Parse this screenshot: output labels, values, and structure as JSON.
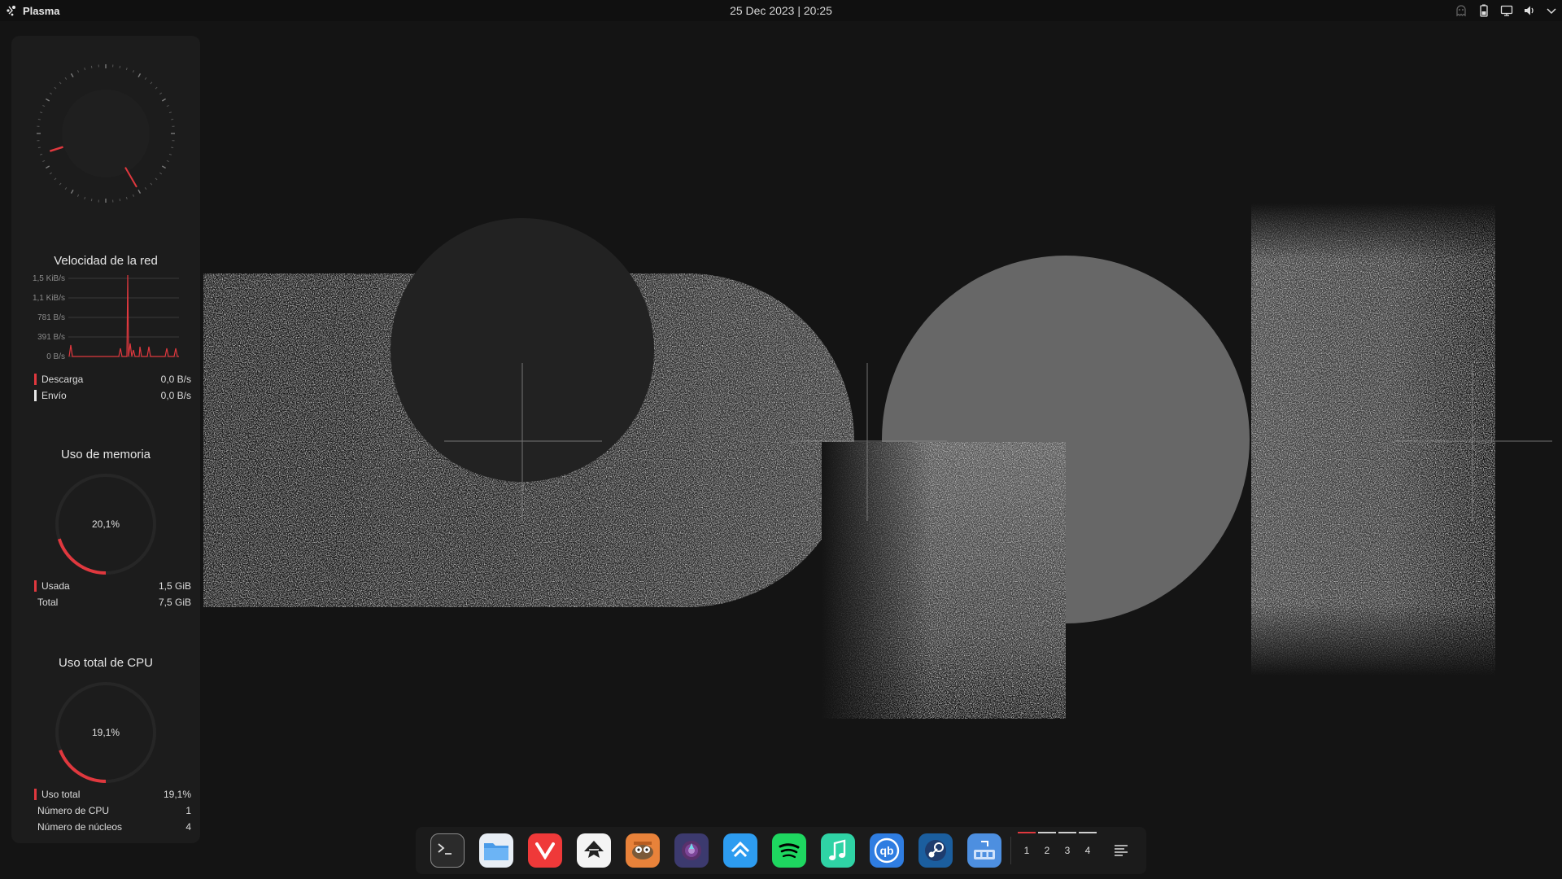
{
  "topbar": {
    "app_name": "Plasma",
    "datetime": "25 Dec 2023 | 20:25",
    "tray_icons": [
      "ghost-icon",
      "battery-icon",
      "display-icon",
      "volume-icon",
      "chevron-down-icon"
    ]
  },
  "sidebar": {
    "analog_clock": {
      "hour": 8,
      "minute": 25
    },
    "network": {
      "title": "Velocidad de la red",
      "y_ticks": [
        "1,5 KiB/s",
        "1,1 KiB/s",
        "781 B/s",
        "391 B/s",
        "0 B/s"
      ],
      "download_label": "Descarga",
      "download_value": "0,0 B/s",
      "upload_label": "Envío",
      "upload_value": "0,0 B/s"
    },
    "memory": {
      "title": "Uso de memoria",
      "percent_text": "20,1%",
      "percent": 20.1,
      "used_label": "Usada",
      "used_value": "1,5 GiB",
      "total_label": "Total",
      "total_value": "7,5 GiB"
    },
    "cpu": {
      "title": "Uso total de CPU",
      "percent_text": "19,1%",
      "percent": 19.1,
      "usage_label": "Uso total",
      "usage_value": "19,1%",
      "cpu_count_label": "Número de CPU",
      "cpu_count_value": "1",
      "cores_label": "Número de núcleos",
      "cores_value": "4"
    }
  },
  "dock": {
    "apps": [
      "terminal-icon",
      "files-icon",
      "vivaldi-icon",
      "inkscape-icon",
      "gimp-icon",
      "tor-icon",
      "kdeconnect-icon",
      "spotify-icon",
      "music-icon",
      "qbittorrent-icon",
      "steam-icon",
      "app-launcher-icon"
    ],
    "pager": [
      "1",
      "2",
      "3",
      "4"
    ]
  },
  "colors": {
    "accent": "#e0383e",
    "panel": "#1c1c1c",
    "background": "#141414"
  }
}
